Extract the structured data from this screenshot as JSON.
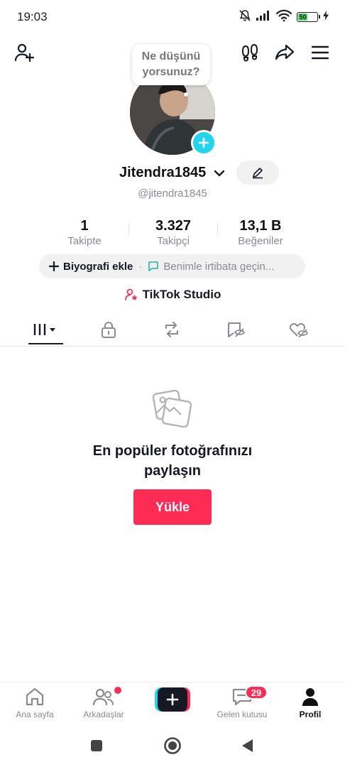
{
  "status_bar": {
    "time": "19:03",
    "battery_level": "50",
    "icons": [
      "mute-bell-icon",
      "signal-icon",
      "wifi-icon",
      "battery-icon",
      "charging-bolt-icon"
    ]
  },
  "top_nav": {
    "icons": [
      "add-friend-icon",
      "footprints-icon",
      "share-icon",
      "menu-icon"
    ]
  },
  "profile": {
    "thought_bubble": "Ne düşünü yorsunuz?",
    "thought_line1": "Ne düşünü",
    "thought_line2": "yorsunuz?",
    "display_name": "Jitendra1845",
    "handle": "@jitendra1845",
    "stats": [
      {
        "value": "1",
        "label": "Takipte"
      },
      {
        "value": "3.327",
        "label": "Takipçi"
      },
      {
        "value": "13,1 B",
        "label": "Beğeniler"
      }
    ],
    "bio_add": "Biyografi ekle",
    "bio_separator": "·",
    "contact": "Benimle irtibata geçin...",
    "studio": "TikTok Studio"
  },
  "tabs": [
    "videos-grid-icon",
    "lock-icon",
    "repost-icon",
    "favorites-icon",
    "liked-icon"
  ],
  "empty_state": {
    "title_line1": "En popüler fotoğrafınızı",
    "title_line2": "paylaşın",
    "button": "Yükle"
  },
  "bottom_nav": {
    "items": [
      {
        "label": "Ana sayfa",
        "icon": "home-icon"
      },
      {
        "label": "Arkadaşlar",
        "icon": "friends-icon"
      },
      {
        "label": "",
        "icon": "plus-icon"
      },
      {
        "label": "Gelen kutusu",
        "icon": "inbox-icon"
      },
      {
        "label": "Profil",
        "icon": "profile-icon"
      }
    ],
    "inbox_badge": "29"
  },
  "colors": {
    "accent_red": "#fe2c55",
    "accent_cyan": "#20d5ec",
    "text_primary": "#161823",
    "text_secondary": "#8a8b91"
  }
}
